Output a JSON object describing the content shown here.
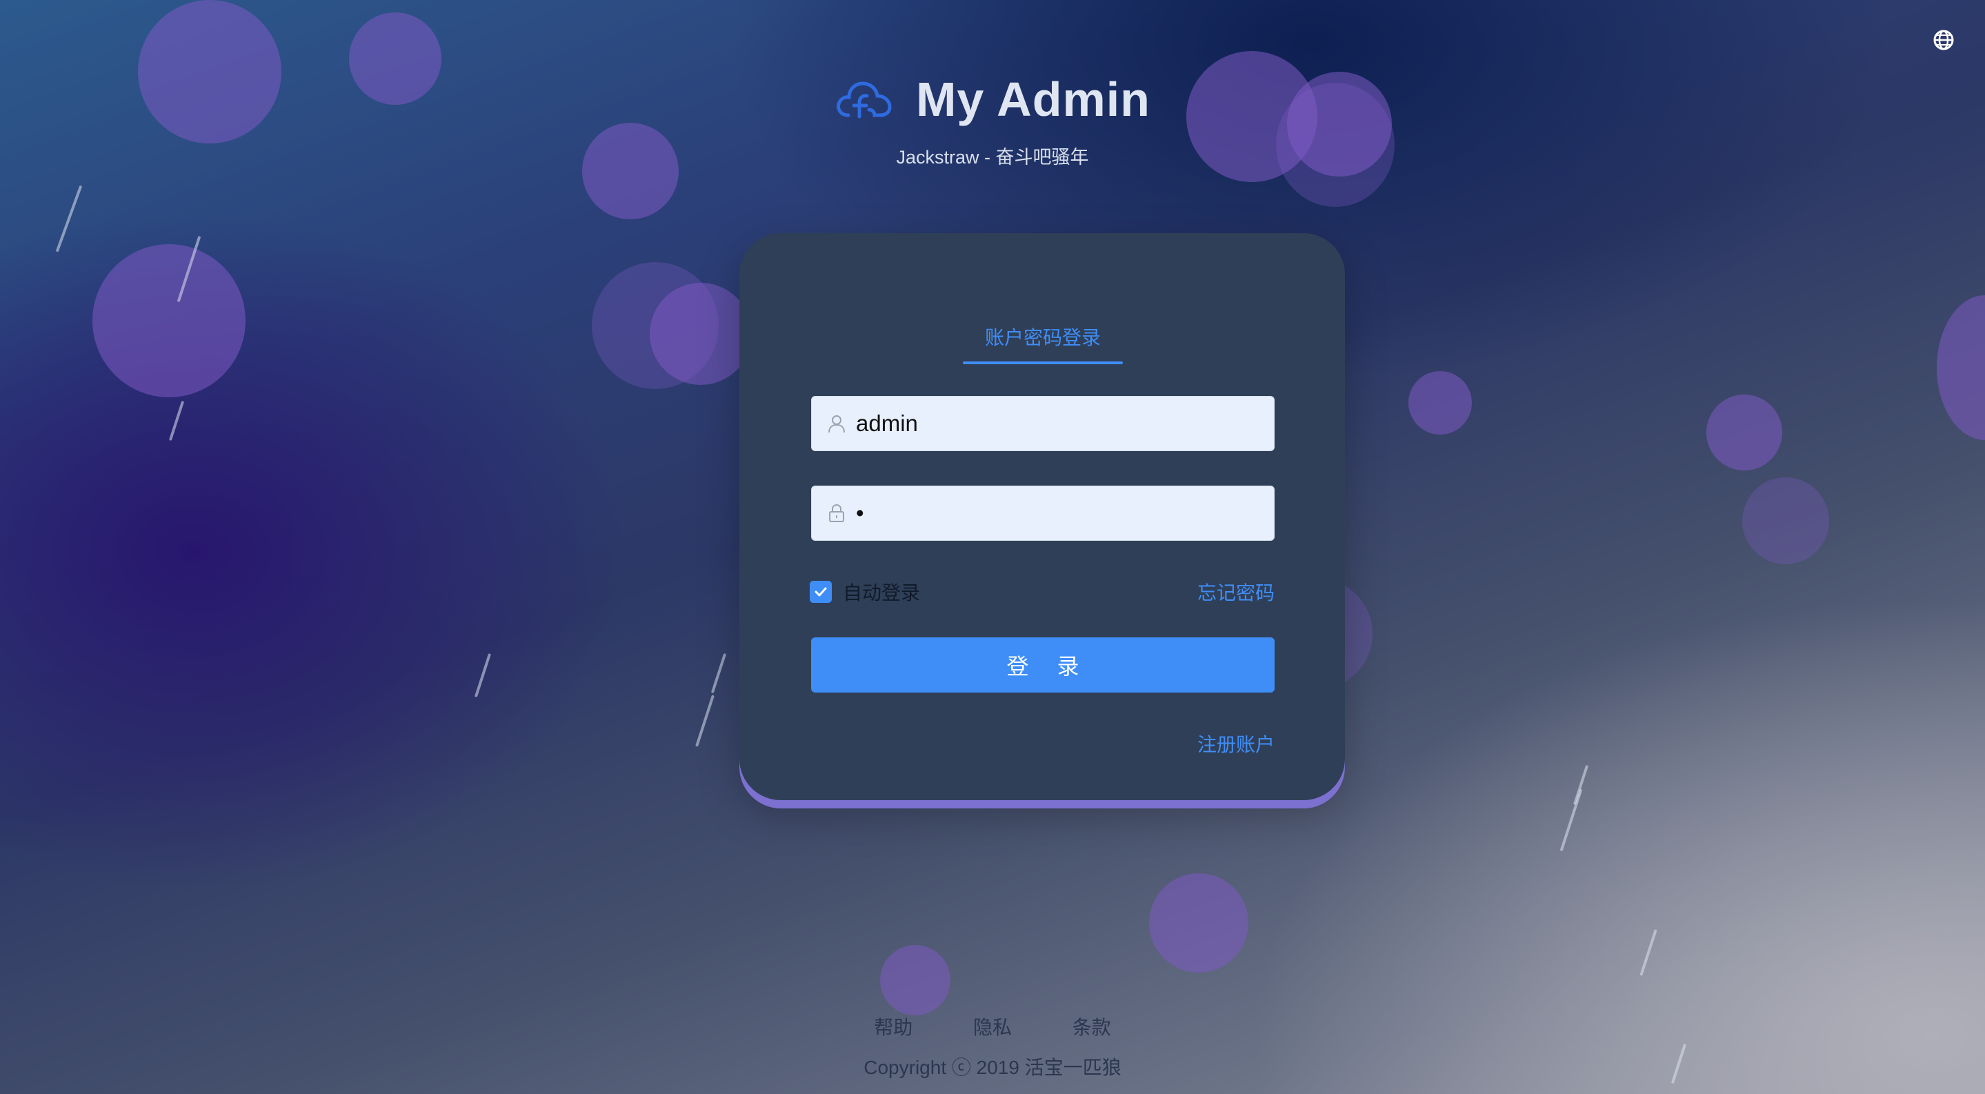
{
  "app": {
    "title": "My Admin",
    "subtitle": "Jackstraw - 奋斗吧骚年",
    "logo_icon": "cloud-f-logo-icon",
    "accent_color": "#3f8ef7",
    "card_edge_color": "#7c70d0"
  },
  "toolbar": {
    "language_icon": "globe-icon"
  },
  "login": {
    "tab_label": "账户密码登录",
    "username": {
      "icon": "user-icon",
      "value": "admin"
    },
    "password": {
      "icon": "lock-icon",
      "value": "•"
    },
    "auto_login": {
      "label": "自动登录",
      "checked": true
    },
    "forgot_password_label": "忘记密码",
    "submit_label": "登 录",
    "register_label": "注册账户"
  },
  "footer": {
    "links": [
      "帮助",
      "隐私",
      "条款"
    ],
    "copyright": "Copyright ⓒ 2019 活宝一匹狼"
  }
}
